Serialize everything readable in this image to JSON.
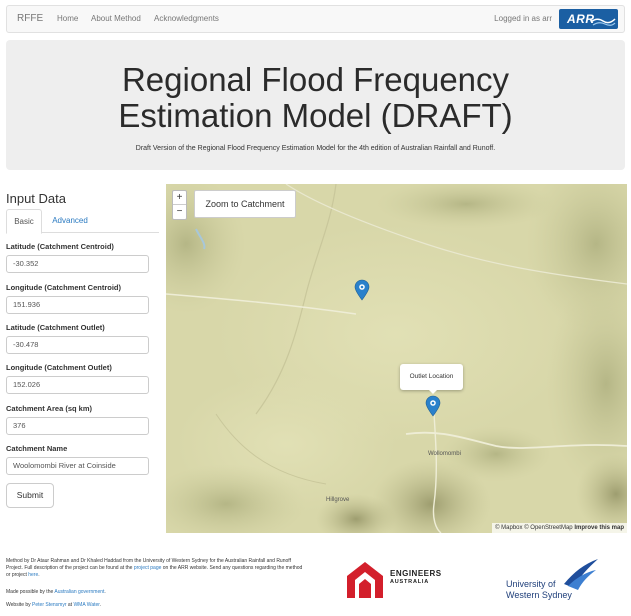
{
  "navbar": {
    "brand": "RFFE",
    "links": [
      "Home",
      "About Method",
      "Acknowledgments"
    ],
    "user": "Logged in as arr",
    "logo_text": "ARR"
  },
  "header": {
    "title_line1": "Regional Flood Frequency",
    "title_line2": "Estimation Model (DRAFT)",
    "subtitle": "Draft Version of the Regional Flood Frequency Estimation Model for the 4th edition of Australian Rainfall and Runoff."
  },
  "input": {
    "title": "Input Data",
    "tabs": [
      "Basic",
      "Advanced"
    ],
    "fields": [
      {
        "label": "Latitude (Catchment Centroid)",
        "value": "-30.352"
      },
      {
        "label": "Longitude (Catchment Centroid)",
        "value": "151.936"
      },
      {
        "label": "Latitude (Catchment Outlet)",
        "value": "-30.478"
      },
      {
        "label": "Longitude (Catchment Outlet)",
        "value": "152.026"
      },
      {
        "label": "Catchment Area (sq km)",
        "value": "376"
      },
      {
        "label": "Catchment Name",
        "value": "Woolomombi River at Coinside"
      }
    ],
    "submit": "Submit"
  },
  "map": {
    "zoom_in": "+",
    "zoom_out": "−",
    "zoom_catchment": "Zoom to Catchment",
    "popup": "Outlet Location",
    "towns": [
      "Wollomombi",
      "Hillgrove"
    ],
    "attribution_mapbox": "© Mapbox",
    "attribution_osm": "© OpenStreetMap",
    "attribution_improve": "Improve this map",
    "marker_color": "#2a81cb"
  },
  "footer": {
    "credit_1": "Method by Dr Ataur Rahman and Dr Khaled Haddad from the University of Western Sydney for the Australian Rainfall and Runoff",
    "credit_2a": "Project. Full description of the project can be found at the ",
    "credit_2_link": "project page",
    "credit_2b": " on the ARR website. Send any questions regarding the method",
    "credit_3a": "or project ",
    "credit_3_link": "here",
    "credit_3b": ".",
    "support_a": "Made possible by the ",
    "support_link": "Australian government",
    "support_b": ".",
    "website_a": "Website by ",
    "website_link1": "Peter Stensmyr",
    "website_b": " at ",
    "website_link2": "WMA Water",
    "website_c": ".",
    "ea_line1": "ENGINEERS",
    "ea_line2": "AUSTRALIA",
    "uws_line1": "University of",
    "uws_line2": "Western Sydney"
  }
}
